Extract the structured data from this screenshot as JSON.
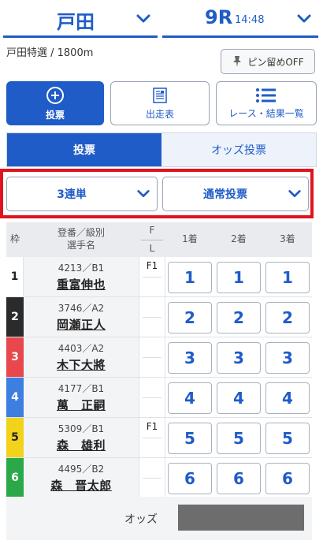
{
  "header": {
    "venue": "戸田",
    "race_no": "9R",
    "race_time": "14:48",
    "race_info": "戸田特選 / 1800m",
    "pin_label": "ピン留めOFF"
  },
  "nav": {
    "vote": "投票",
    "entry": "出走表",
    "result": "レース・結果一覧"
  },
  "tabs": {
    "vote": "投票",
    "odds_vote": "オッズ投票"
  },
  "selectors": {
    "bet_type": "3連単",
    "method": "通常投票"
  },
  "table": {
    "col_waku": "枠",
    "col_reg": "登番／級別",
    "col_name": "選手名",
    "col_f": "F",
    "col_l": "L",
    "col_1": "1着",
    "col_2": "2着",
    "col_3": "3着",
    "rows": [
      {
        "waku": "1",
        "reg": "4213／B1",
        "name": "重富伸也",
        "f": "F1",
        "l": "",
        "b1": "1",
        "b2": "1",
        "b3": "1"
      },
      {
        "waku": "2",
        "reg": "3746／A2",
        "name": "岡瀬正人",
        "f": "",
        "l": "",
        "b1": "2",
        "b2": "2",
        "b3": "2"
      },
      {
        "waku": "3",
        "reg": "4403／A2",
        "name": "木下大將",
        "f": "",
        "l": "",
        "b1": "3",
        "b2": "3",
        "b3": "3"
      },
      {
        "waku": "4",
        "reg": "4177／B1",
        "name": "萬　正嗣",
        "f": "",
        "l": "",
        "b1": "4",
        "b2": "4",
        "b3": "4"
      },
      {
        "waku": "5",
        "reg": "5309／B1",
        "name": "森　雄利",
        "f": "F1",
        "l": "",
        "b1": "5",
        "b2": "5",
        "b3": "5"
      },
      {
        "waku": "6",
        "reg": "4495／B2",
        "name": "森　晋太郎",
        "f": "",
        "l": "",
        "b1": "6",
        "b2": "6",
        "b3": "6"
      }
    ],
    "odds_label": "オッズ"
  },
  "colors": {
    "accent": "#1f5cc7",
    "highlight": "#e0141e",
    "waku": [
      "#ffffff",
      "#2b2b2b",
      "#e8474c",
      "#3d7fe0",
      "#f2d21a",
      "#2aa84a"
    ]
  }
}
